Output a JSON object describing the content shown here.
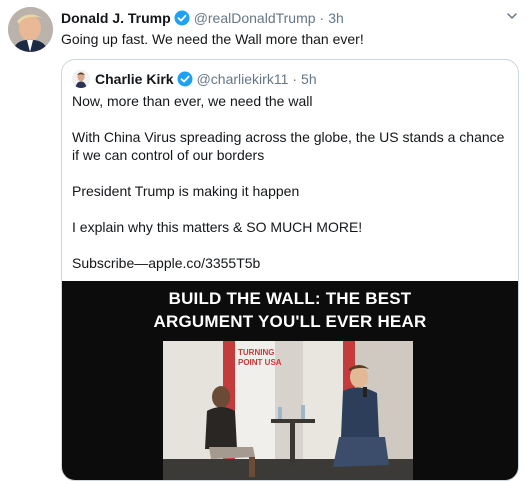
{
  "tweet": {
    "author_name": "Donald J. Trump",
    "author_handle": "@realDonaldTrump",
    "separator": "·",
    "time": "3h",
    "text": "Going up fast. We need the Wall more than ever!"
  },
  "quoted_tweet": {
    "author_name": "Charlie Kirk",
    "author_handle": "@charliekirk11",
    "separator": "·",
    "time": "5h",
    "paragraphs": [
      "Now, more than ever, we need the wall",
      "With China Virus spreading across the globe, the US stands a chance if we can control of our borders",
      "President Trump is making it happen",
      "I explain why this matters & SO MUCH MORE!",
      "Subscribe—apple.co/3355T5b"
    ],
    "video": {
      "title_line1": "BUILD THE WALL: THE BEST",
      "title_line2": "ARGUMENT YOU'LL EVER HEAR",
      "backdrop_text": "TURNING\nPOINT USA"
    }
  },
  "colors": {
    "verified": "#1da1f2",
    "secondary_text": "#657786",
    "border": "#ccd6dd"
  },
  "icons": [
    "verified-badge-icon",
    "caret-down-icon"
  ]
}
